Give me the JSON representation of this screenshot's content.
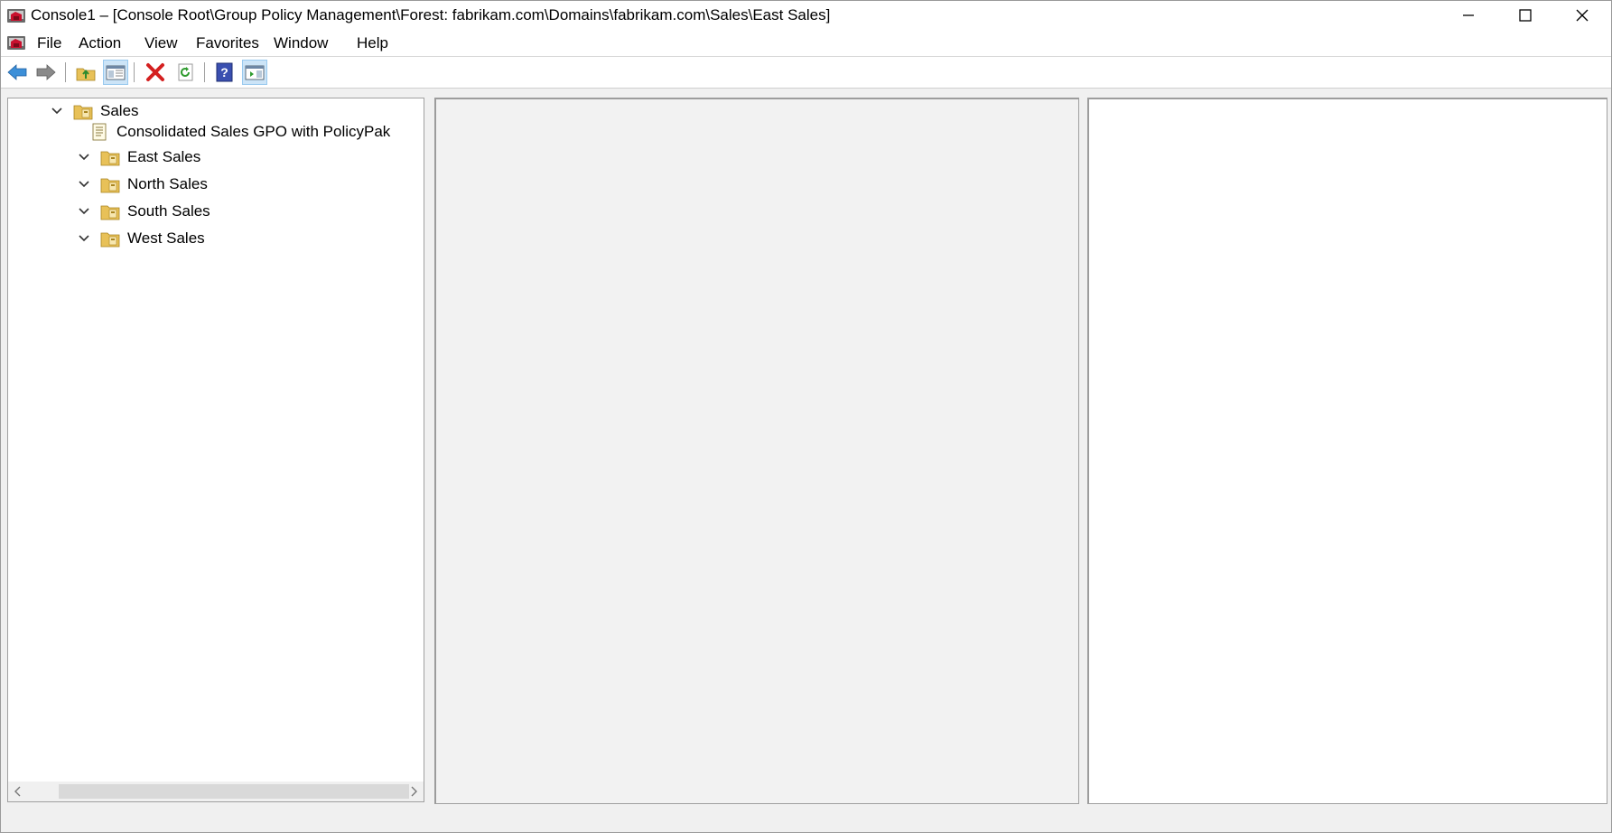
{
  "window": {
    "title": "Console1 – [Console Root\\Group Policy Management\\Forest: fabrikam.com\\Domains\\fabrikam.com\\Sales\\East Sales]"
  },
  "menu": {
    "items": [
      {
        "label": "File"
      },
      {
        "label": "Action"
      },
      {
        "label": "View"
      },
      {
        "label": "Favorites"
      },
      {
        "label": "Window"
      },
      {
        "label": "Help"
      }
    ]
  },
  "toolbar": {
    "buttons": [
      "back-icon",
      "forward-icon",
      "up-folder-icon",
      "show-hide-tree-icon",
      "delete-icon",
      "refresh-icon",
      "help-icon",
      "show-hide-action-pane-icon"
    ]
  },
  "tree": {
    "nodes": [
      {
        "label": "Sales",
        "icon": "ou-folder-icon",
        "expanded": true
      },
      {
        "label": "Consolidated Sales GPO with PolicyPak",
        "icon": "gpo-link-icon"
      },
      {
        "label": "East Sales",
        "icon": "ou-folder-icon",
        "expanded": true
      },
      {
        "label": "North Sales",
        "icon": "ou-folder-icon",
        "expanded": true
      },
      {
        "label": "South Sales",
        "icon": "ou-folder-icon",
        "expanded": true
      },
      {
        "label": "West Sales",
        "icon": "ou-folder-icon",
        "expanded": true
      }
    ]
  },
  "colors": {
    "accent_pressed": "#cce4f7",
    "delete_red": "#d42020",
    "back_blue": "#3c8fd8",
    "folder_yellow": "#e8c158"
  }
}
